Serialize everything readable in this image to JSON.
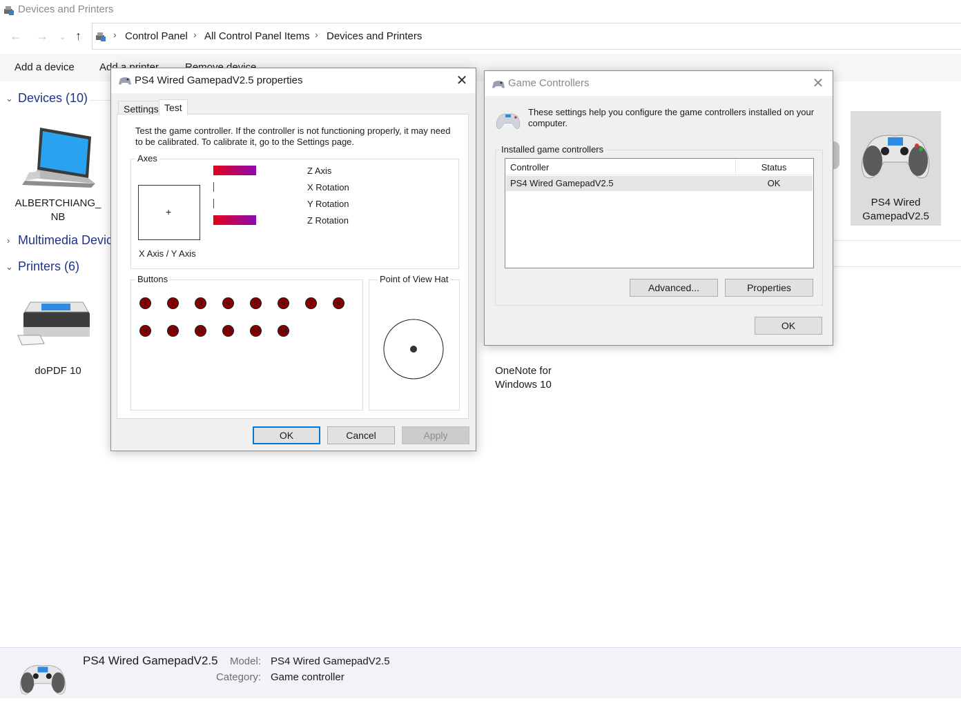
{
  "window": {
    "title": "Devices and Printers"
  },
  "breadcrumb": [
    "Control Panel",
    "All Control Panel Items",
    "Devices and Printers"
  ],
  "toolbar": {
    "add_device": "Add a device",
    "add_printer": "Add a printer",
    "remove_device": "Remove device"
  },
  "groups": {
    "devices": "Devices (10)",
    "multimedia": "Multimedia Devic",
    "printers": "Printers (6)"
  },
  "devices": {
    "laptop_line1": "ALBERTCHIANG_",
    "laptop_line2": "NB",
    "gamepad_line1": "PS4 Wired",
    "gamepad_line2": "GamepadV2.5"
  },
  "printers": {
    "dopdf": "doPDF 10",
    "onenote_line1": "OneNote for",
    "onenote_line2": "Windows 10"
  },
  "details": {
    "name": "PS4 Wired GamepadV2.5",
    "model_key": "Model:",
    "model_val": "PS4 Wired GamepadV2.5",
    "category_key": "Category:",
    "category_val": "Game controller"
  },
  "props_dialog": {
    "title": "PS4 Wired GamepadV2.5 properties",
    "tabs": [
      "Settings",
      "Test"
    ],
    "active_tab": "Test",
    "description_line1": "Test the game controller.  If the controller is not functioning properly, it may need",
    "description_line2": "to be calibrated.  To calibrate it, go to the Settings page.",
    "axes_title": "Axes",
    "axes": [
      {
        "label": "Z Axis",
        "level": 1.0
      },
      {
        "label": "X Rotation",
        "level": 0.0
      },
      {
        "label": "Y Rotation",
        "level": 0.0
      },
      {
        "label": "Z Rotation",
        "level": 1.0
      }
    ],
    "xy_label": "X Axis / Y Axis",
    "xy_cursor": "+",
    "buttons_title": "Buttons",
    "buttons": [
      "1",
      "2",
      "3",
      "4",
      "5",
      "6",
      "7",
      "8",
      "9",
      "10",
      "11",
      "12",
      "13",
      "14"
    ],
    "pov_title": "Point of View Hat",
    "ok": "OK",
    "cancel": "Cancel",
    "apply": "Apply"
  },
  "gc_dialog": {
    "title": "Game Controllers",
    "info": "These settings help you configure the game controllers installed on your computer.",
    "group_title": "Installed game controllers",
    "col_controller": "Controller",
    "col_status": "Status",
    "rows": [
      {
        "controller": "PS4 Wired GamepadV2.5",
        "status": "OK"
      }
    ],
    "advanced": "Advanced...",
    "properties": "Properties",
    "ok": "OK"
  },
  "colors": {
    "accent": "#0078d7",
    "group_title": "#1e3287",
    "axis_start": "#e3001b",
    "axis_end": "#8a0ab0"
  }
}
